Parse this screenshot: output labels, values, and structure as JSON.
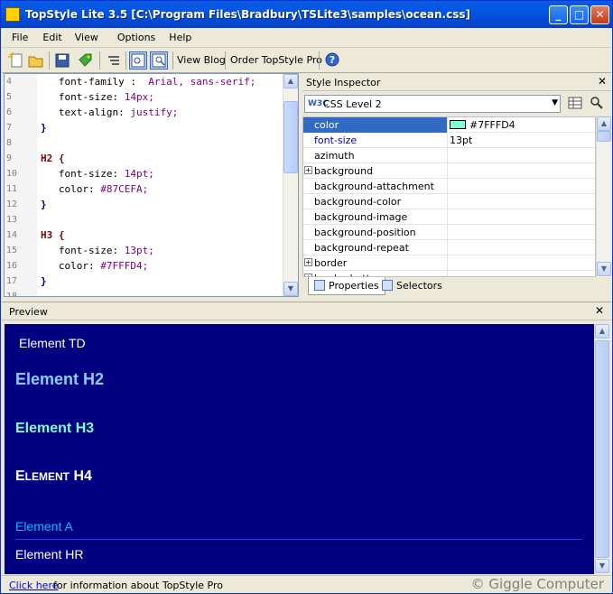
{
  "window": {
    "title": "TopStyle Lite 3.5 [C:\\Program Files\\Bradbury\\TSLite3\\samples\\ocean.css]"
  },
  "menu": [
    "File",
    "Edit",
    "View",
    "Options",
    "Help"
  ],
  "toolbar": {
    "view_blog": "View Blog",
    "order_pro": "Order TopStyle Pro"
  },
  "editor": {
    "lines": [
      {
        "num": "4",
        "text": "   font-family :  Arial, sans-serif;"
      },
      {
        "num": "5",
        "text": "   font-size: 14px;"
      },
      {
        "num": "6",
        "text": "   text-align: justify;"
      },
      {
        "num": "7",
        "text": "}"
      },
      {
        "num": "8",
        "text": ""
      },
      {
        "num": "9",
        "text": "H2 {"
      },
      {
        "num": "10",
        "text": "   font-size: 14pt;"
      },
      {
        "num": "11",
        "text": "   color: #87CEFA;"
      },
      {
        "num": "12",
        "text": "}"
      },
      {
        "num": "13",
        "text": ""
      },
      {
        "num": "14",
        "text": "H3 {"
      },
      {
        "num": "15",
        "text": "   font-size: 13pt;"
      },
      {
        "num": "16",
        "text": "   color: #7FFFD4;"
      },
      {
        "num": "17",
        "text": "}"
      },
      {
        "num": "18",
        "text": ""
      }
    ]
  },
  "inspector": {
    "title": "Style Inspector",
    "close": "✕",
    "css_level_icon": "W3C",
    "css_level": "CSS Level 2",
    "properties": [
      {
        "name": "color",
        "value": "#7FFFD4",
        "swatch": "#7FFFD4",
        "selected": true
      },
      {
        "name": "font-size",
        "value": "13pt",
        "set": true
      },
      {
        "name": "azimuth",
        "value": ""
      },
      {
        "name": "background",
        "value": "",
        "expandable": true
      },
      {
        "name": "background-attachment",
        "value": ""
      },
      {
        "name": "background-color",
        "value": ""
      },
      {
        "name": "background-image",
        "value": ""
      },
      {
        "name": "background-position",
        "value": ""
      },
      {
        "name": "background-repeat",
        "value": ""
      },
      {
        "name": "border",
        "value": "",
        "expandable": true
      },
      {
        "name": "border-bottom",
        "value": "",
        "expandable": true
      }
    ],
    "tabs": [
      "Properties",
      "Selectors"
    ]
  },
  "preview": {
    "title": "Preview",
    "close": "✕",
    "elements": {
      "td": "Element TD",
      "h2": "Element H2",
      "h3": "Element H3",
      "h4_small_e": "E",
      "h4_rest_lement": "LEMENT",
      "h4_rest_h4": " H4",
      "a": "Element A",
      "hr": "Element HR"
    }
  },
  "status": {
    "link": "Click here",
    "info": "for information about TopStyle Pro",
    "watermark": "© Giggle Computer"
  },
  "colors": {
    "title_bar": "#0455e4",
    "preview_bg": "#000080",
    "h2": "#87CEFA",
    "h3": "#7FFFD4",
    "link": "#00bfff"
  }
}
